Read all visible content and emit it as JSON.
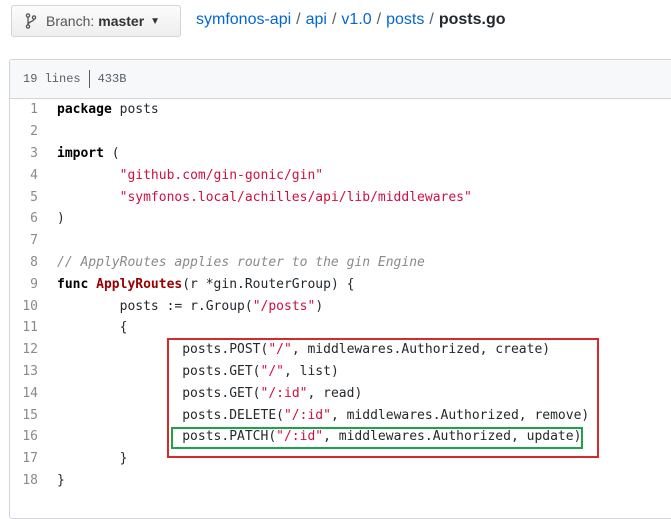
{
  "branch": {
    "label": "Branch:",
    "name": "master"
  },
  "breadcrumb": {
    "items": [
      "symfonos-api",
      "api",
      "v1.0",
      "posts"
    ],
    "separator": "/",
    "current": "posts.go"
  },
  "file_info": {
    "lines": "19 lines",
    "size": "433B"
  },
  "code": {
    "line_numbers": [
      "1",
      "2",
      "3",
      "4",
      "5",
      "6",
      "7",
      "8",
      "9",
      "10",
      "11",
      "12",
      "13",
      "14",
      "15",
      "16",
      "17",
      "18"
    ],
    "l1_kw": "package",
    "l1_rest": " posts",
    "l3_kw": "import",
    "l3_rest": " (",
    "l4_str": "\"github.com/gin-gonic/gin\"",
    "l5_str": "\"symfonos.local/achilles/api/lib/middlewares\"",
    "l6": ")",
    "l8_cmt": "// ApplyRoutes applies router to the gin Engine",
    "l9_kw": "func",
    "l9_fn": "ApplyRoutes",
    "l9_rest": "(r *gin.RouterGroup) {",
    "l10_a": "posts := r.Group(",
    "l10_str": "\"/posts\"",
    "l10_b": ")",
    "l11": "{",
    "l12_a": "posts.POST(",
    "l12_str": "\"/\"",
    "l12_b": ", middlewares.Authorized, create)",
    "l13_a": "posts.GET(",
    "l13_str": "\"/\"",
    "l13_b": ", list)",
    "l14_a": "posts.GET(",
    "l14_str": "\"/:id\"",
    "l14_b": ", read)",
    "l15_a": "posts.DELETE(",
    "l15_str": "\"/:id\"",
    "l15_b": ", middlewares.Authorized, remove)",
    "l16_a": "posts.PATCH(",
    "l16_str": "\"/:id\"",
    "l16_b": ", middlewares.Authorized, update)",
    "l17": "}",
    "l18": "}"
  },
  "colors": {
    "highlight_red": "#d42a2a",
    "highlight_green": "#1fa34a",
    "link": "#0366d6"
  }
}
